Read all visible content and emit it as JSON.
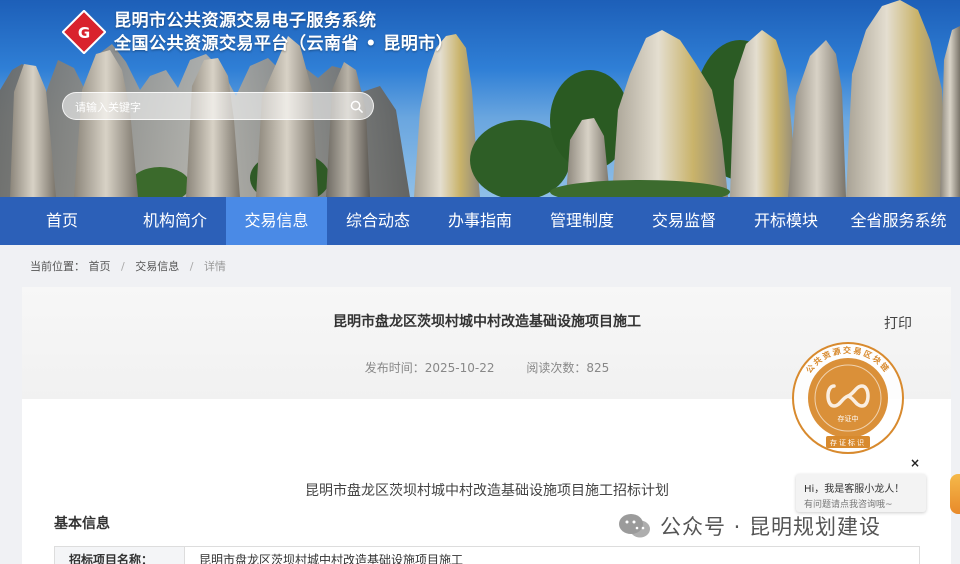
{
  "header": {
    "title_line1": "昆明市公共资源交易电子服务系统",
    "title_line2": "全国公共资源交易平台（云南省 • 昆明市）",
    "search_placeholder": "请输入关键字"
  },
  "nav": {
    "items": [
      {
        "label": "首页",
        "active": false
      },
      {
        "label": "机构简介",
        "active": false
      },
      {
        "label": "交易信息",
        "active": true
      },
      {
        "label": "综合动态",
        "active": false
      },
      {
        "label": "办事指南",
        "active": false
      },
      {
        "label": "管理制度",
        "active": false
      },
      {
        "label": "交易监督",
        "active": false
      },
      {
        "label": "开标模块",
        "active": false
      },
      {
        "label": "全省服务系统",
        "active": false
      }
    ]
  },
  "breadcrumb": {
    "prefix": "当前位置：",
    "home": "首页",
    "section": "交易信息",
    "current": "详情"
  },
  "article": {
    "title": "昆明市盘龙区茨坝村城中村改造基础设施项目施工",
    "publish_label": "发布时间：",
    "publish_date": "2025-10-22",
    "views_label": "阅读次数：",
    "views": "825",
    "print_label": "打印",
    "plan_title": "昆明市盘龙区茨坝村城中村改造基础设施项目施工招标计划",
    "section_title": "基本信息",
    "table": [
      {
        "label": "招标项目名称：",
        "value": "昆明市盘龙区茨坝村城中村改造基础设施项目施工"
      }
    ]
  },
  "seal": {
    "ring_text": "公共资源交易区块链",
    "center_text": "存证中",
    "bottom_text": "存证标识"
  },
  "chat": {
    "line1": "Hi，我是客服小龙人！",
    "line2": "有问题请点我咨询哦~",
    "close": "×"
  },
  "watermark": {
    "text": "公众号 · 昆明规划建设"
  },
  "colors": {
    "nav_bg": "#2c60b8",
    "nav_active": "#4a8ae6",
    "logo_red": "#d9232d",
    "seal_orange": "#d88a2e"
  }
}
